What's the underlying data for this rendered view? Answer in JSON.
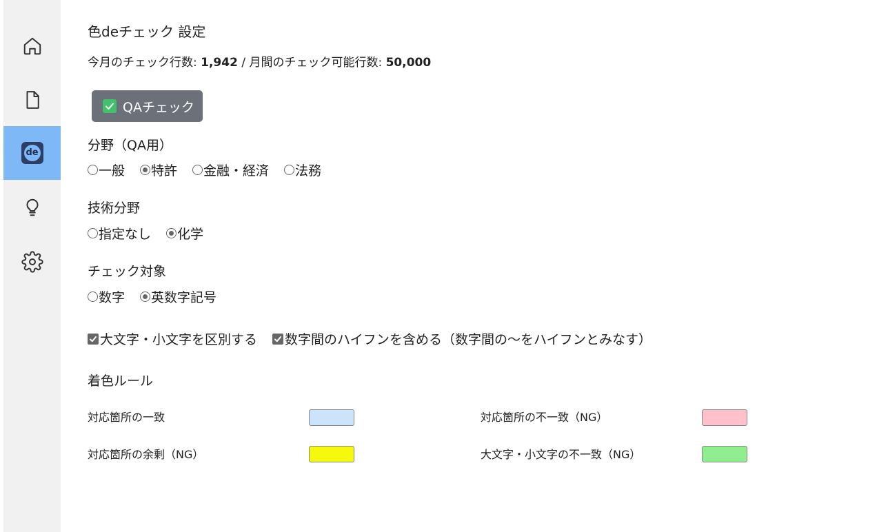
{
  "sidebar": {
    "items": [
      {
        "icon": "home-icon",
        "active": false
      },
      {
        "icon": "document-icon",
        "active": false
      },
      {
        "icon": "iro-de-check-logo-icon",
        "active": true,
        "logo_text": "de"
      },
      {
        "icon": "lightbulb-icon",
        "active": false
      },
      {
        "icon": "gear-icon",
        "active": false
      }
    ]
  },
  "header": {
    "title": "色deチェック 設定",
    "usage_prefix": "今月のチェック行数: ",
    "usage_count": "1,942",
    "usage_sep": " / 月間のチェック可能行数: ",
    "usage_limit": "50,000"
  },
  "qa_button": {
    "label": "QAチェック",
    "checked": true
  },
  "field_qa": {
    "label": "分野（QA用）",
    "options": [
      {
        "label": "一般",
        "selected": false
      },
      {
        "label": "特許",
        "selected": true
      },
      {
        "label": "金融・経済",
        "selected": false
      },
      {
        "label": "法務",
        "selected": false
      }
    ]
  },
  "tech_field": {
    "label": "技術分野",
    "options": [
      {
        "label": "指定なし",
        "selected": false
      },
      {
        "label": "化学",
        "selected": true
      }
    ]
  },
  "check_target": {
    "label": "チェック対象",
    "options": [
      {
        "label": "数字",
        "selected": false
      },
      {
        "label": "英数字記号",
        "selected": true
      }
    ]
  },
  "checkboxes": [
    {
      "label": "大文字・小文字を区別する",
      "checked": true
    },
    {
      "label": "数字間のハイフンを含める（数字間の〜をハイフンとみなす）",
      "checked": true
    }
  ],
  "color_rules": {
    "label": "着色ルール",
    "rules": [
      {
        "label": "対応箇所の一致",
        "color": "#cce4fb"
      },
      {
        "label": "対応箇所の不一致（NG）",
        "color": "#ffc0cb"
      },
      {
        "label": "対応箇所の余剰（NG）",
        "color": "#f5f90c"
      },
      {
        "label": "大文字・小文字の不一致（NG）",
        "color": "#90ee90"
      }
    ]
  }
}
